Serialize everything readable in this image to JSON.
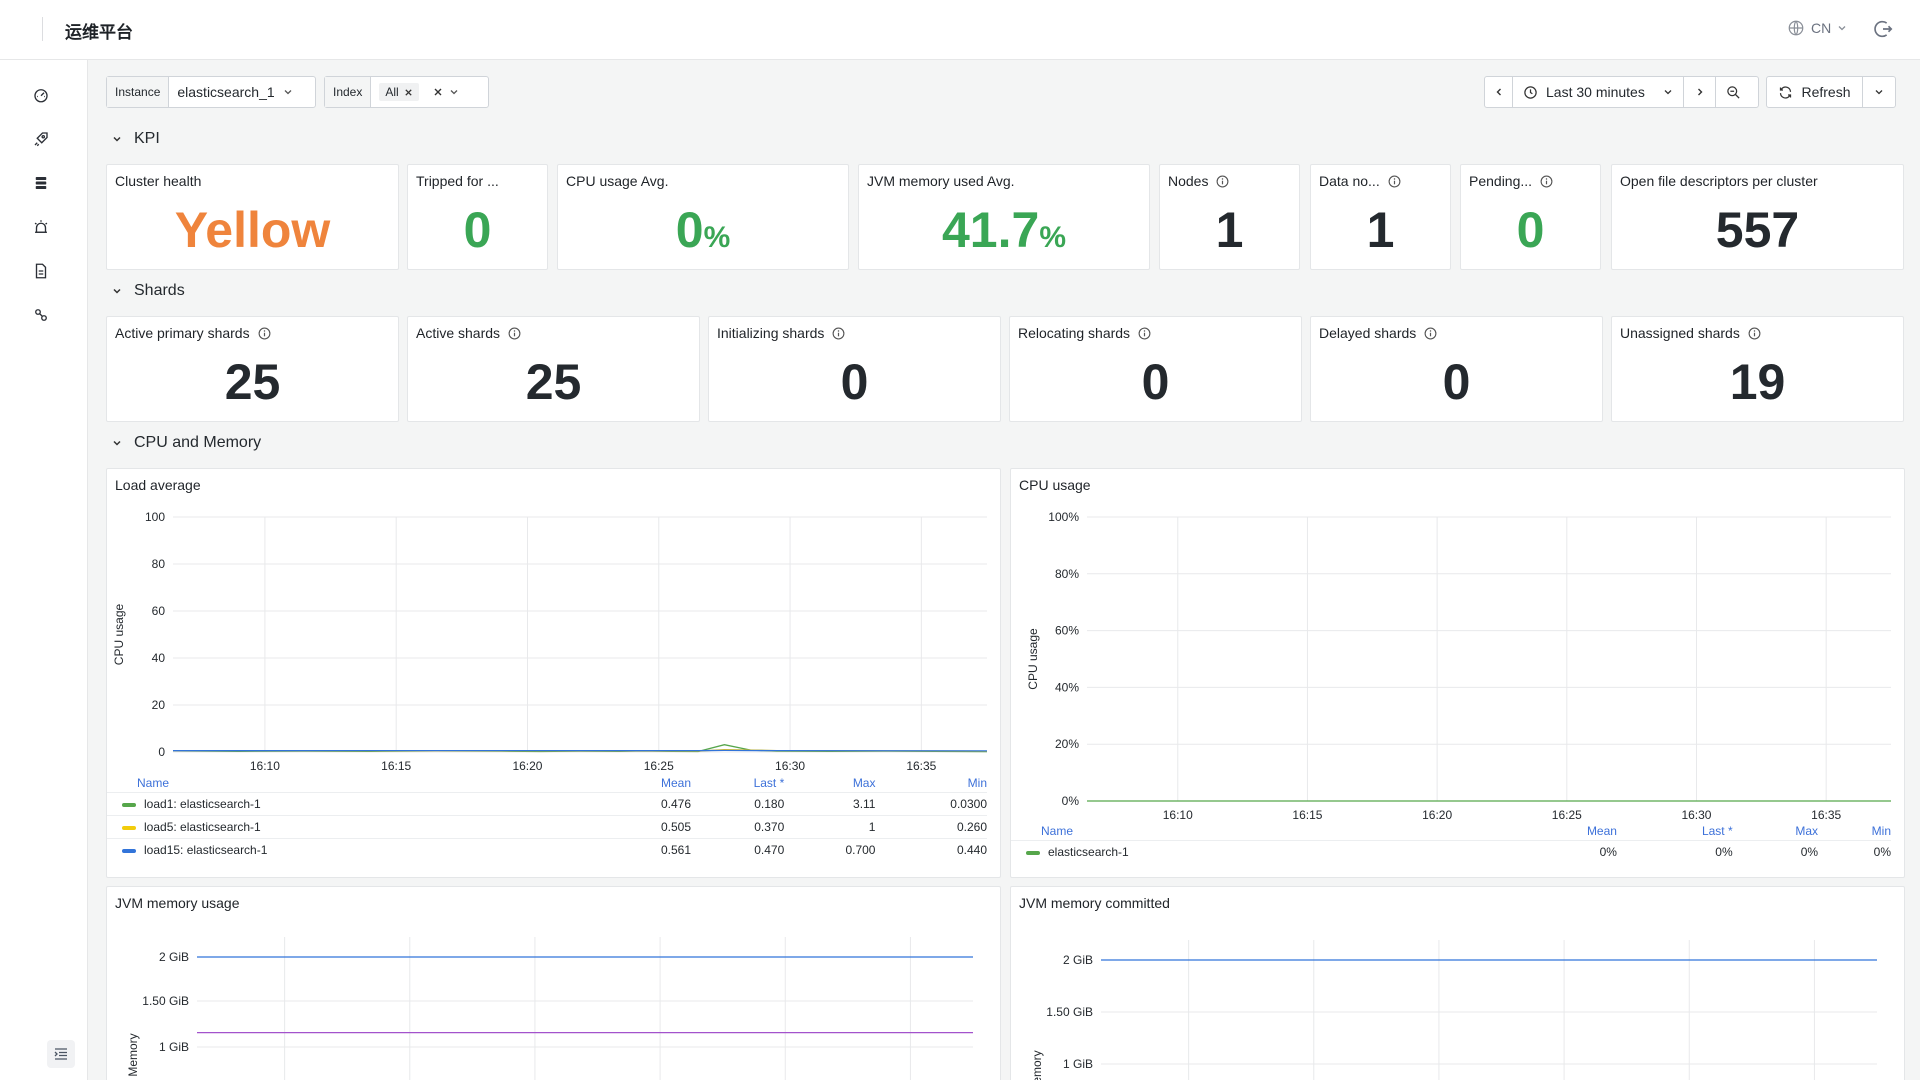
{
  "app": {
    "brand": "运维平台",
    "lang": "CN"
  },
  "sidebar": {
    "items": [
      "dashboard-icon",
      "rocket-icon",
      "database-icon",
      "alarm-icon",
      "document-icon",
      "link-icon"
    ]
  },
  "filters": {
    "instance": {
      "label": "Instance",
      "value": "elasticsearch_1"
    },
    "index": {
      "label": "Index",
      "value": "All"
    }
  },
  "timepicker": {
    "range": "Last 30 minutes",
    "refresh": "Refresh"
  },
  "sections": {
    "kpi": "KPI",
    "shards": "Shards",
    "cpu_memory": "CPU and Memory"
  },
  "kpi": [
    {
      "title": "Cluster health",
      "value": "Yellow",
      "unit": "",
      "color": "#ef843c",
      "info": false
    },
    {
      "title": "Tripped for ...",
      "value": "0",
      "unit": "",
      "color": "#3aa655",
      "info": false
    },
    {
      "title": "CPU usage Avg.",
      "value": "0",
      "unit": "%",
      "color": "#3aa655",
      "info": false
    },
    {
      "title": "JVM memory used Avg.",
      "value": "41.7",
      "unit": "%",
      "color": "#3aa655",
      "info": false
    },
    {
      "title": "Nodes",
      "value": "1",
      "unit": "",
      "color": "#24292e",
      "info": true
    },
    {
      "title": "Data no...",
      "value": "1",
      "unit": "",
      "color": "#24292e",
      "info": true
    },
    {
      "title": "Pending...",
      "value": "0",
      "unit": "",
      "color": "#3aa655",
      "info": true
    },
    {
      "title": "Open file descriptors per cluster",
      "value": "557",
      "unit": "",
      "color": "#24292e",
      "info": false
    }
  ],
  "shards": [
    {
      "title": "Active primary shards",
      "value": "25"
    },
    {
      "title": "Active shards",
      "value": "25"
    },
    {
      "title": "Initializing shards",
      "value": "0"
    },
    {
      "title": "Relocating shards",
      "value": "0"
    },
    {
      "title": "Delayed shards",
      "value": "0"
    },
    {
      "title": "Unassigned shards",
      "value": "19"
    }
  ],
  "load_panel": {
    "title": "Load average",
    "legend_headers": {
      "name": "Name",
      "mean": "Mean",
      "last": "Last *",
      "max": "Max",
      "min": "Min"
    },
    "legend": [
      {
        "name": "load1: elasticsearch-1",
        "color": "#56a64b",
        "mean": "0.476",
        "last": "0.180",
        "max": "3.11",
        "min": "0.0300"
      },
      {
        "name": "load5: elasticsearch-1",
        "color": "#f2cc0c",
        "mean": "0.505",
        "last": "0.370",
        "max": "1",
        "min": "0.260"
      },
      {
        "name": "load15: elasticsearch-1",
        "color": "#3274d9",
        "mean": "0.561",
        "last": "0.470",
        "max": "0.700",
        "min": "0.440"
      }
    ]
  },
  "cpu_panel": {
    "title": "CPU usage",
    "legend_headers": {
      "name": "Name",
      "mean": "Mean",
      "last": "Last *",
      "max": "Max",
      "min": "Min"
    },
    "legend": [
      {
        "name": "elasticsearch-1",
        "color": "#56a64b",
        "mean": "0%",
        "last": "0%",
        "max": "0%",
        "min": "0%"
      }
    ]
  },
  "jvm_usage_panel": {
    "title": "JVM memory usage"
  },
  "jvm_committed_panel": {
    "title": "JVM memory committed"
  },
  "chart_data": [
    {
      "type": "line",
      "title": "Load average",
      "ylabel": "CPU usage",
      "ylim": [
        0,
        100
      ],
      "yticks": [
        "0",
        "20",
        "40",
        "60",
        "80",
        "100"
      ],
      "xticks": [
        "16:10",
        "16:15",
        "16:20",
        "16:25",
        "16:30",
        "16:35"
      ],
      "series": [
        {
          "name": "load1: elasticsearch-1",
          "color": "#56a64b",
          "points": [
            [
              0,
              0.5
            ],
            [
              5,
              0.3
            ],
            [
              10,
              0.4
            ],
            [
              15,
              0.3
            ],
            [
              20,
              0.5
            ],
            [
              25,
              0.4
            ],
            [
              28,
              0.2
            ],
            [
              31,
              0.4
            ],
            [
              34,
              0.3
            ],
            [
              36,
              0.5
            ],
            [
              38,
              0.3
            ],
            [
              40,
              0.2
            ],
            [
              42,
              3.11
            ],
            [
              44,
              0.8
            ],
            [
              46,
              0.4
            ],
            [
              50,
              0.3
            ],
            [
              54,
              0.4
            ],
            [
              58,
              0.3
            ],
            [
              62,
              0.18
            ]
          ]
        },
        {
          "name": "load5: elasticsearch-1",
          "color": "#f2cc0c",
          "points": [
            [
              0,
              0.5
            ],
            [
              20,
              0.5
            ],
            [
              40,
              0.4
            ],
            [
              42,
              1
            ],
            [
              46,
              0.6
            ],
            [
              62,
              0.37
            ]
          ]
        },
        {
          "name": "load15: elasticsearch-1",
          "color": "#3274d9",
          "points": [
            [
              0,
              0.55
            ],
            [
              20,
              0.6
            ],
            [
              40,
              0.55
            ],
            [
              42,
              0.7
            ],
            [
              46,
              0.6
            ],
            [
              62,
              0.47
            ]
          ]
        }
      ]
    },
    {
      "type": "line",
      "title": "CPU usage",
      "ylabel": "CPU usage",
      "ylim": [
        0,
        100
      ],
      "yticks": [
        "0%",
        "20%",
        "40%",
        "60%",
        "80%",
        "100%"
      ],
      "xticks": [
        "16:10",
        "16:15",
        "16:20",
        "16:25",
        "16:30",
        "16:35"
      ],
      "series": [
        {
          "name": "elasticsearch-1",
          "color": "#56a64b",
          "points": [
            [
              0,
              0
            ],
            [
              62,
              0
            ]
          ]
        }
      ]
    },
    {
      "type": "line",
      "title": "JVM memory usage",
      "ylabel": "Memory",
      "yticks": [
        "1 GiB",
        "1.50 GiB",
        "2 GiB"
      ],
      "series": [
        {
          "color": "#3274d9",
          "values": [
            2,
            2
          ]
        },
        {
          "color": "#a352cc",
          "values": [
            1.16,
            1.16
          ]
        }
      ]
    },
    {
      "type": "line",
      "title": "JVM memory committed",
      "ylabel": "Memory",
      "yticks": [
        "1 GiB",
        "1.50 GiB",
        "2 GiB"
      ],
      "series": [
        {
          "color": "#3274d9",
          "values": [
            2,
            2
          ]
        }
      ]
    }
  ]
}
